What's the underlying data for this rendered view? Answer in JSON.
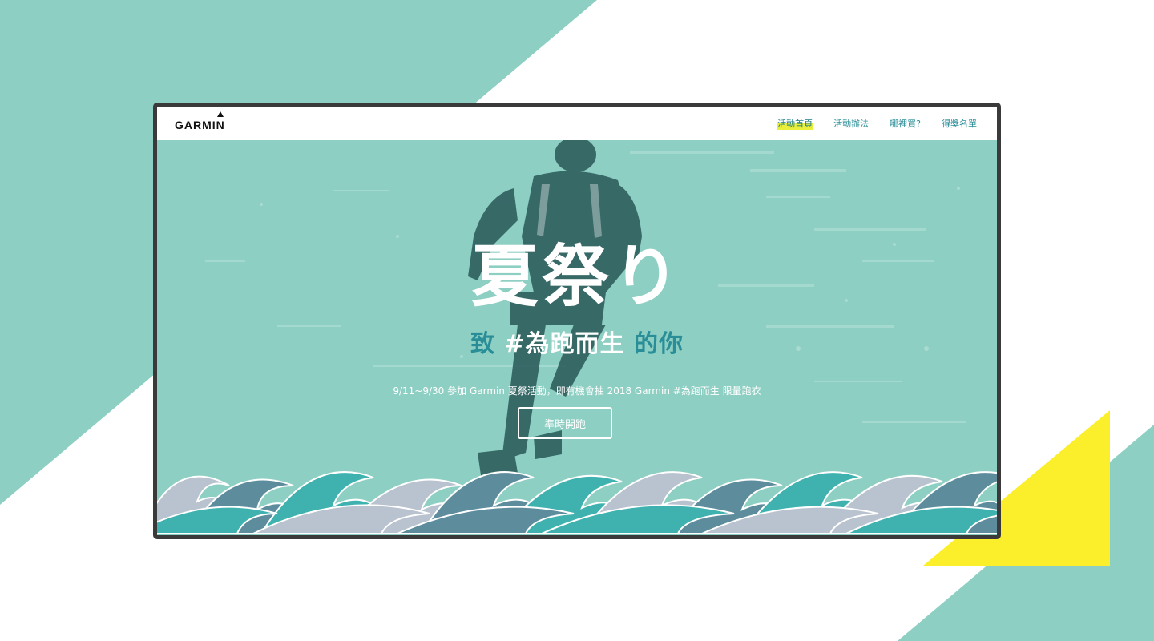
{
  "brand": {
    "name": "GARMIN"
  },
  "nav": {
    "items": [
      {
        "label": "活動首頁",
        "active": true
      },
      {
        "label": "活動辦法",
        "active": false
      },
      {
        "label": "哪裡買?",
        "active": false
      },
      {
        "label": "得獎名單",
        "active": false
      }
    ]
  },
  "hero": {
    "title": "夏祭り",
    "subtitle_part1": "致 ",
    "subtitle_part2": "#為跑而生",
    "subtitle_part3": " 的你",
    "description": "9/11~9/30 參加 Garmin 夏祭活動，即有機會抽 2018 Garmin #為跑而生 限量跑衣",
    "cta_label": "準時開跑"
  },
  "colors": {
    "mint": "#8ecfc3",
    "teal_text": "#2a8e98",
    "highlight_yellow": "#e9ef3a",
    "accent_yellow": "#fbef2b",
    "frame": "#3a3a3a",
    "wave_blue": "#5d8c9c",
    "wave_teal": "#3fb2b0",
    "wave_grey": "#b9c2cf"
  },
  "icons": {
    "logo_mark": "triangle-icon"
  }
}
